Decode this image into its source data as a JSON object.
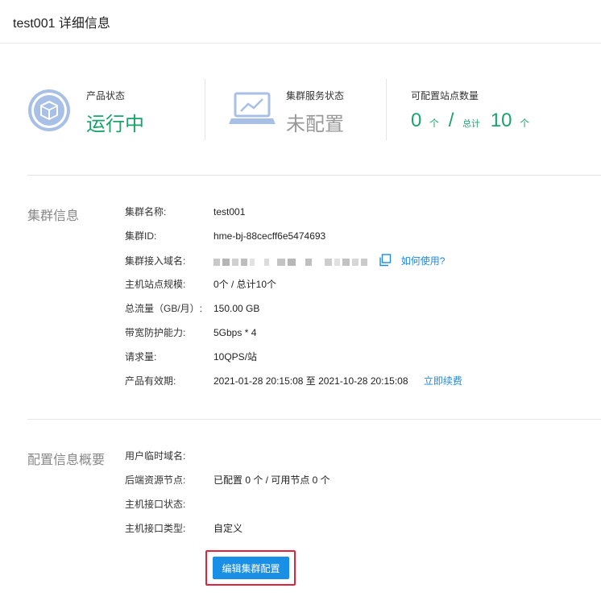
{
  "header": {
    "title": "test001 详细信息"
  },
  "stats": {
    "product_status": {
      "label": "产品状态",
      "value": "运行中",
      "value_color": "#1aa36b"
    },
    "cluster_status": {
      "label": "集群服务状态",
      "value": "未配置",
      "value_color": "#999999"
    },
    "site_count": {
      "label": "可配置站点数量",
      "current": "0",
      "unit": "个",
      "sep": "/",
      "total_label": "总计",
      "total": "10",
      "unit2": "个"
    }
  },
  "cluster_info": {
    "title": "集群信息",
    "rows": [
      {
        "key": "集群名称:",
        "value": "test001"
      },
      {
        "key": "集群ID:",
        "value": "hme-bj-88cecff6e5474693"
      },
      {
        "key": "集群接入域名:",
        "value": "",
        "link": "如何使用?"
      },
      {
        "key": "主机站点规模:",
        "value": "0个 / 总计10个"
      },
      {
        "key": "总流量（GB/月）:",
        "value": "150.00 GB"
      },
      {
        "key": "带宽防护能力:",
        "value": "5Gbps * 4"
      },
      {
        "key": "请求量:",
        "value": "10QPS/站"
      },
      {
        "key": "产品有效期:",
        "value": "2021-01-28 20:15:08 至 2021-10-28 20:15:08",
        "link": "立即续费"
      }
    ]
  },
  "config_info": {
    "title": "配置信息概要",
    "rows": [
      {
        "key": "用户临时域名:",
        "value": ""
      },
      {
        "key": "后端资源节点:",
        "value": "已配置 0 个 / 可用节点 0 个"
      },
      {
        "key": "主机接口状态:",
        "value": ""
      },
      {
        "key": "主机接口类型:",
        "value": "自定义"
      }
    ],
    "button": "编辑集群配置"
  },
  "colors": {
    "accent": "#1e88e5",
    "button": "#1a8fe6",
    "highlight": "#e0223a",
    "green": "#1aa36b"
  },
  "icons": {
    "product": "cube-icon",
    "cluster": "laptop-chart-icon",
    "copy": "copy-icon"
  }
}
